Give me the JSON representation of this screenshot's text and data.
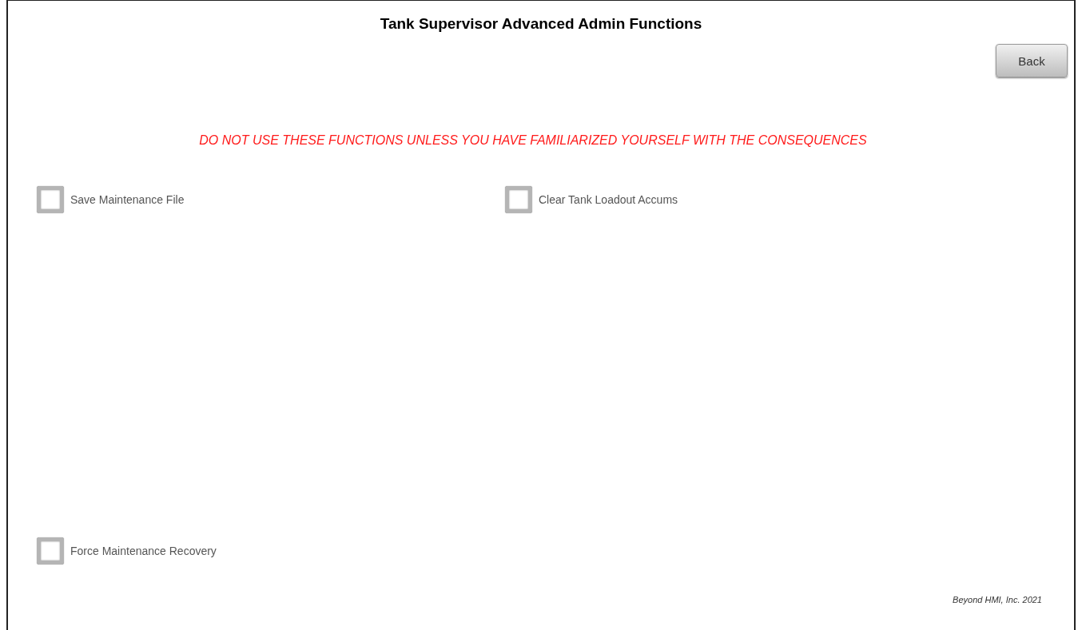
{
  "title": "Tank Supervisor Advanced Admin Functions",
  "back_button": "Back",
  "warning": "DO NOT USE THESE FUNCTIONS UNLESS YOU HAVE FAMILIARIZED YOURSELF WITH THE CONSEQUENCES",
  "functions": [
    {
      "label": "Save Maintenance File",
      "checked": false
    },
    {
      "label": "Clear Tank Loadout Accums",
      "checked": false
    }
  ],
  "bottom_functions": [
    {
      "label": "Force Maintenance Recovery",
      "checked": false
    }
  ],
  "footer": "Beyond HMI, Inc.  2021"
}
